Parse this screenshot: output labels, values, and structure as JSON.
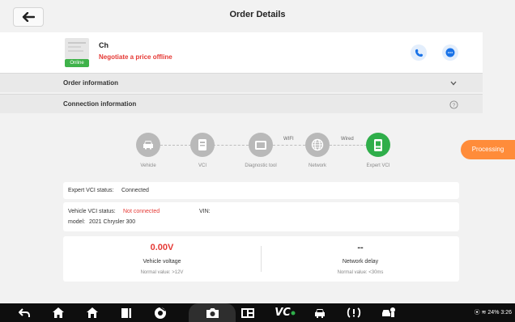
{
  "header": {
    "title": "Order Details",
    "back_icon": "back-arrow-icon"
  },
  "order": {
    "name": "Ch",
    "note": "Negotiate a price offline",
    "badge": "Online",
    "actions": [
      "phone-icon",
      "chat-icon"
    ]
  },
  "sections": {
    "order_info": "Order information",
    "connection_info": "Connection information"
  },
  "topology": {
    "nodes": [
      {
        "label": "Vehicle",
        "icon": "car-icon"
      },
      {
        "label": "VCI",
        "icon": "vci-device-icon"
      },
      {
        "label": "Diagnostic tool",
        "icon": "tablet-icon"
      },
      {
        "label": "Network",
        "icon": "globe-icon"
      },
      {
        "label": "Expert VCI",
        "icon": "expert-vci-icon"
      }
    ],
    "links": {
      "wifi": "WIFI",
      "wired": "Wired"
    },
    "active_color": "#2fae4a"
  },
  "processing_label": "Processing",
  "expert_status": {
    "label": "Expert VCI status:",
    "value": "Connected"
  },
  "vehicle_status": {
    "vci_label": "Vehicle VCI status:",
    "vci_value": "Not connected",
    "vin_label": "VIN:",
    "model_label": "model:",
    "model_value": "2021 Chrysler 300"
  },
  "metrics": {
    "voltage": {
      "value": "0.00V",
      "label": "Vehicle voltage",
      "normal": "Normal value: >12V"
    },
    "delay": {
      "value": "--",
      "label": "Network delay",
      "normal": "Normal value: <30ms"
    }
  },
  "navbar": {
    "status": "24% 3:26",
    "icons": [
      "back-icon",
      "home-icon",
      "house-icon",
      "recent-apps-icon",
      "chrome-icon",
      "camera-icon",
      "screen-icon",
      "vci-icon",
      "car-diagnostic-icon",
      "tire-pressure-icon",
      "service-icon"
    ],
    "vci_text": "VC"
  }
}
